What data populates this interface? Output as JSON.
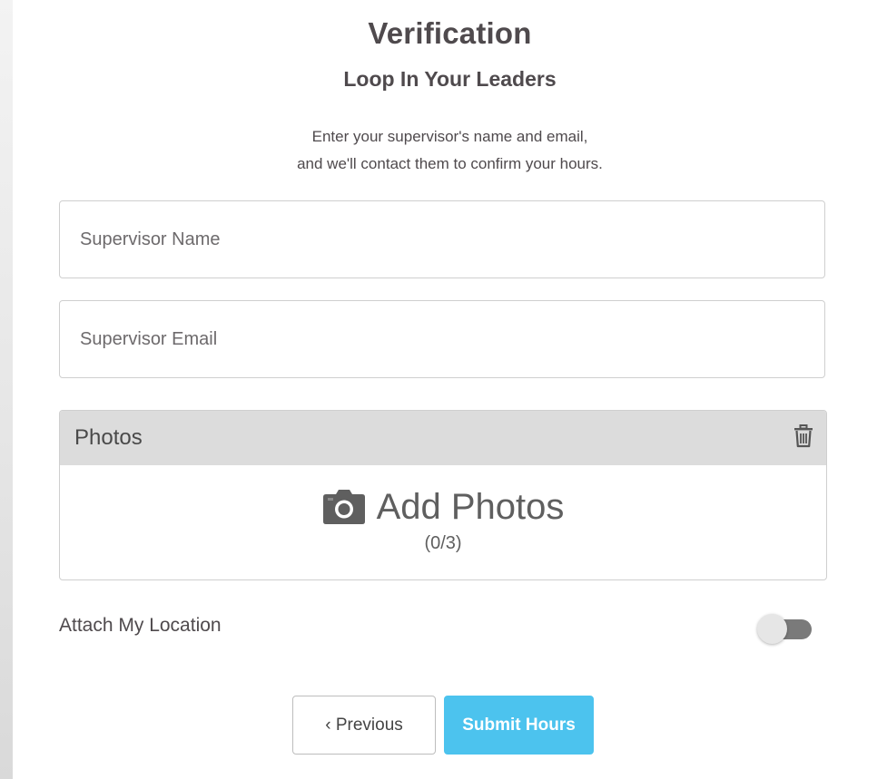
{
  "header": {
    "title": "Verification",
    "subtitle": "Loop In Your Leaders",
    "instructions_line1": "Enter your supervisor's name and email,",
    "instructions_line2": "and we'll contact them to confirm your hours."
  },
  "form": {
    "supervisor_name": {
      "placeholder": "Supervisor Name",
      "value": ""
    },
    "supervisor_email": {
      "placeholder": "Supervisor Email",
      "value": ""
    }
  },
  "photos": {
    "title": "Photos",
    "add_label": "Add Photos",
    "count_text": "(0/3)",
    "count": 0,
    "max": 3,
    "icons": {
      "delete": "trash-icon",
      "add": "camera-icon"
    }
  },
  "location": {
    "label": "Attach My Location",
    "enabled": false
  },
  "actions": {
    "previous_label": "‹ Previous",
    "submit_label": "Submit Hours"
  },
  "colors": {
    "accent": "#4cc3ee",
    "heading": "#4f4a4d",
    "photos_header_bg": "#dcdcdc"
  }
}
